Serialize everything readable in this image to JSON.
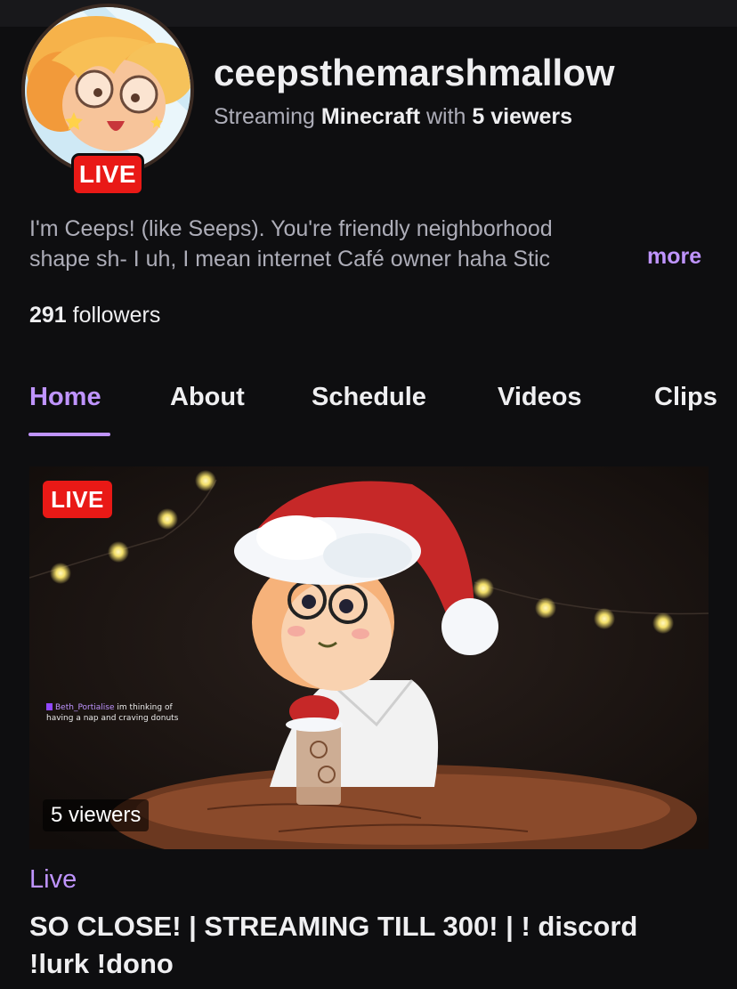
{
  "channel": {
    "name": "ceepsthemarshmallow",
    "status_prefix": "Streaming",
    "game": "Minecraft",
    "status_mid": "with",
    "viewers_text": "5 viewers",
    "live_badge": "LIVE"
  },
  "bio": {
    "line1": "I'm Ceeps! (like Seeps). You're friendly neighborhood",
    "line2": "shape sh- I uh, I mean internet Café owner haha Stic",
    "more": "more"
  },
  "followers": {
    "count": "291",
    "label": "followers"
  },
  "tabs": [
    {
      "label": "Home",
      "active": true
    },
    {
      "label": "About"
    },
    {
      "label": "Schedule"
    },
    {
      "label": "Videos"
    },
    {
      "label": "Clips"
    }
  ],
  "video": {
    "live_badge": "LIVE",
    "viewers": "5 viewers",
    "chat_user": "Beth_Portialise",
    "chat_line1": "im thinking of",
    "chat_line2": "having a nap and craving donuts"
  },
  "live_label": "Live",
  "stream_title": "SO CLOSE! | STREAMING TILL 300! | ! discord !lurk !dono",
  "colors": {
    "accent": "#bf94ff",
    "live": "#e91916",
    "background": "#0e0e10"
  }
}
